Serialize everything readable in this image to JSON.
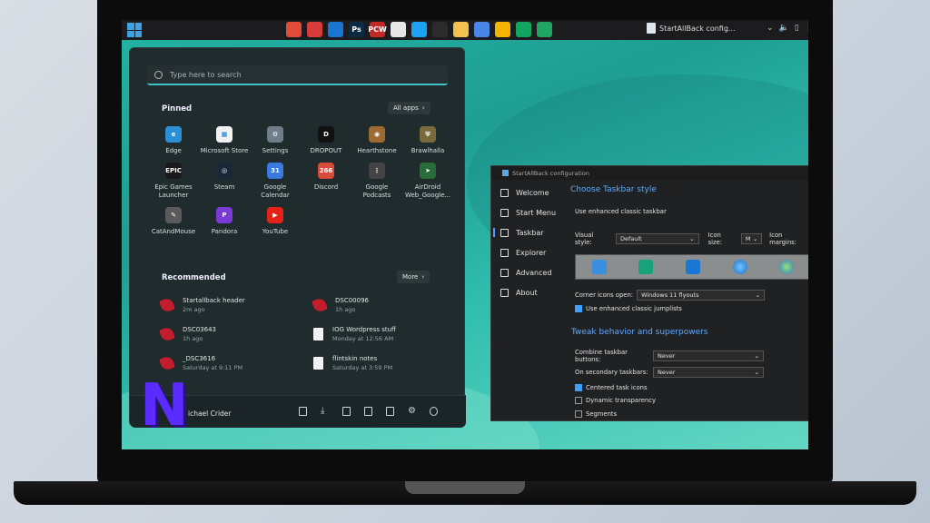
{
  "taskbar": {
    "apps": [
      {
        "icon": "chrome-icon",
        "label": "",
        "color": "#e04b3a"
      },
      {
        "icon": "gmail-icon",
        "label": "",
        "color": "#d83b3b"
      },
      {
        "icon": "outlook-icon",
        "label": "",
        "color": "#1976d2"
      },
      {
        "icon": "photoshop-icon",
        "label": "Ps",
        "color": "#0d2a45"
      },
      {
        "icon": "pcw-icon",
        "label": "PCW",
        "color": "#c62828"
      },
      {
        "icon": "slack-icon",
        "label": "",
        "color": "#e7e7e7"
      },
      {
        "icon": "twitter-icon",
        "label": "",
        "color": "#1da1f2"
      },
      {
        "icon": "monday-icon",
        "label": "",
        "color": "#2b2b2b"
      },
      {
        "icon": "folder-icon",
        "label": "",
        "color": "#f2c14e"
      },
      {
        "icon": "docs-icon",
        "label": "",
        "color": "#4a86e8"
      },
      {
        "icon": "keep-icon",
        "label": "",
        "color": "#f6b400"
      },
      {
        "icon": "hangouts-icon",
        "label": "",
        "color": "#11a55f"
      },
      {
        "icon": "phone-icon",
        "label": "",
        "color": "#1fa463"
      }
    ],
    "active_window": "StartAllBack config..."
  },
  "start_menu": {
    "search_placeholder": "Type here to search",
    "pinned_title": "Pinned",
    "all_apps_label": "All apps",
    "pinned": [
      {
        "label": "Edge",
        "icon": "edge-icon",
        "color": "#2c8fd6",
        "glyph": "e"
      },
      {
        "label": "Microsoft Store",
        "icon": "store-icon",
        "color": "#f1f1f1",
        "glyph": "▦"
      },
      {
        "label": "Settings",
        "icon": "settings-icon",
        "color": "#6f7f8a",
        "glyph": "⚙"
      },
      {
        "label": "DROPOUT",
        "icon": "dropout-icon",
        "color": "#111111",
        "glyph": "D"
      },
      {
        "label": "Hearthstone",
        "icon": "hearthstone-icon",
        "color": "#9b6b33",
        "glyph": "◉"
      },
      {
        "label": "Brawlhalla",
        "icon": "brawlhalla-icon",
        "color": "#7a6a3b",
        "glyph": "⛨"
      },
      {
        "label": "Epic Games\nLauncher",
        "icon": "epic-games-icon",
        "color": "#1a1a1a",
        "glyph": "EPIC"
      },
      {
        "label": "Steam",
        "icon": "steam-icon",
        "color": "#1b2838",
        "glyph": "◎"
      },
      {
        "label": "Google Calendar",
        "icon": "calendar-icon",
        "color": "#3a79e0",
        "glyph": "31"
      },
      {
        "label": "Discord",
        "icon": "discord-icon",
        "color": "#d84a3a",
        "glyph": "266"
      },
      {
        "label": "Google Podcasts",
        "icon": "podcasts-icon",
        "color": "#444444",
        "glyph": "⋮"
      },
      {
        "label": "AirDroid\nWeb_Google...",
        "icon": "airdroid-icon",
        "color": "#2a6b3a",
        "glyph": "➤"
      },
      {
        "label": "CatAndMouse",
        "icon": "catandmouse-icon",
        "color": "#5a5a5a",
        "glyph": "✎"
      },
      {
        "label": "Pandora",
        "icon": "pandora-icon",
        "color": "#7b3ad6",
        "glyph": "P"
      },
      {
        "label": "YouTube",
        "icon": "youtube-icon",
        "color": "#e62117",
        "glyph": "▶"
      }
    ],
    "recommended_title": "Recommended",
    "more_label": "More",
    "recommended": [
      {
        "name": "Startallback header",
        "time": "2m ago",
        "icon": "image-file-icon",
        "kind": "pic"
      },
      {
        "name": "DSC00096",
        "time": "1h ago",
        "icon": "image-file-icon",
        "kind": "pic"
      },
      {
        "name": "DSC03643",
        "time": "1h ago",
        "icon": "image-file-icon",
        "kind": "pic"
      },
      {
        "name": "IOG Wordpress stuff",
        "time": "Monday at 12:56 AM",
        "icon": "document-icon",
        "kind": "doc"
      },
      {
        "name": "_DSC3616",
        "time": "Saturday at 9:11 PM",
        "icon": "image-file-icon",
        "kind": "pic"
      },
      {
        "name": "flintskin notes",
        "time": "Saturday at 3:59 PM",
        "icon": "document-icon",
        "kind": "doc"
      }
    ],
    "user_name": "ichael Crider"
  },
  "sab": {
    "title": "StartAllBack configuration",
    "nav": [
      {
        "label": "Welcome",
        "icon": "home-icon",
        "active": false
      },
      {
        "label": "Start Menu",
        "icon": "start-menu-icon",
        "active": false
      },
      {
        "label": "Taskbar",
        "icon": "taskbar-icon",
        "active": true
      },
      {
        "label": "Explorer",
        "icon": "explorer-icon",
        "active": false
      },
      {
        "label": "Advanced",
        "icon": "wrench-icon",
        "active": false
      },
      {
        "label": "About",
        "icon": "info-icon",
        "active": false
      }
    ],
    "heading1": "Choose Taskbar style",
    "enhanced_classic": "Use enhanced classic taskbar",
    "visual_style_label": "Visual style:",
    "visual_style_value": "Default",
    "icon_size_label": "Icon size:",
    "icon_size_value": "M",
    "icon_margins_label": "Icon margins:",
    "corner_icons_label": "Corner icons open:",
    "corner_icons_value": "Windows 11 flyouts",
    "jumplists_label": "Use enhanced classic jumplists",
    "heading2": "Tweak behavior and superpowers",
    "combine_label": "Combine taskbar buttons:",
    "combine_value": "Never",
    "secondary_label": "On secondary taskbars:",
    "secondary_value": "Never",
    "centered_label": "Centered task icons",
    "dynamic_label": "Dynamic transparency",
    "segments_label": "Segments",
    "centered_checked": true,
    "dynamic_checked": false,
    "segments_checked": false,
    "jumplists_checked": true
  },
  "watermark": "N"
}
